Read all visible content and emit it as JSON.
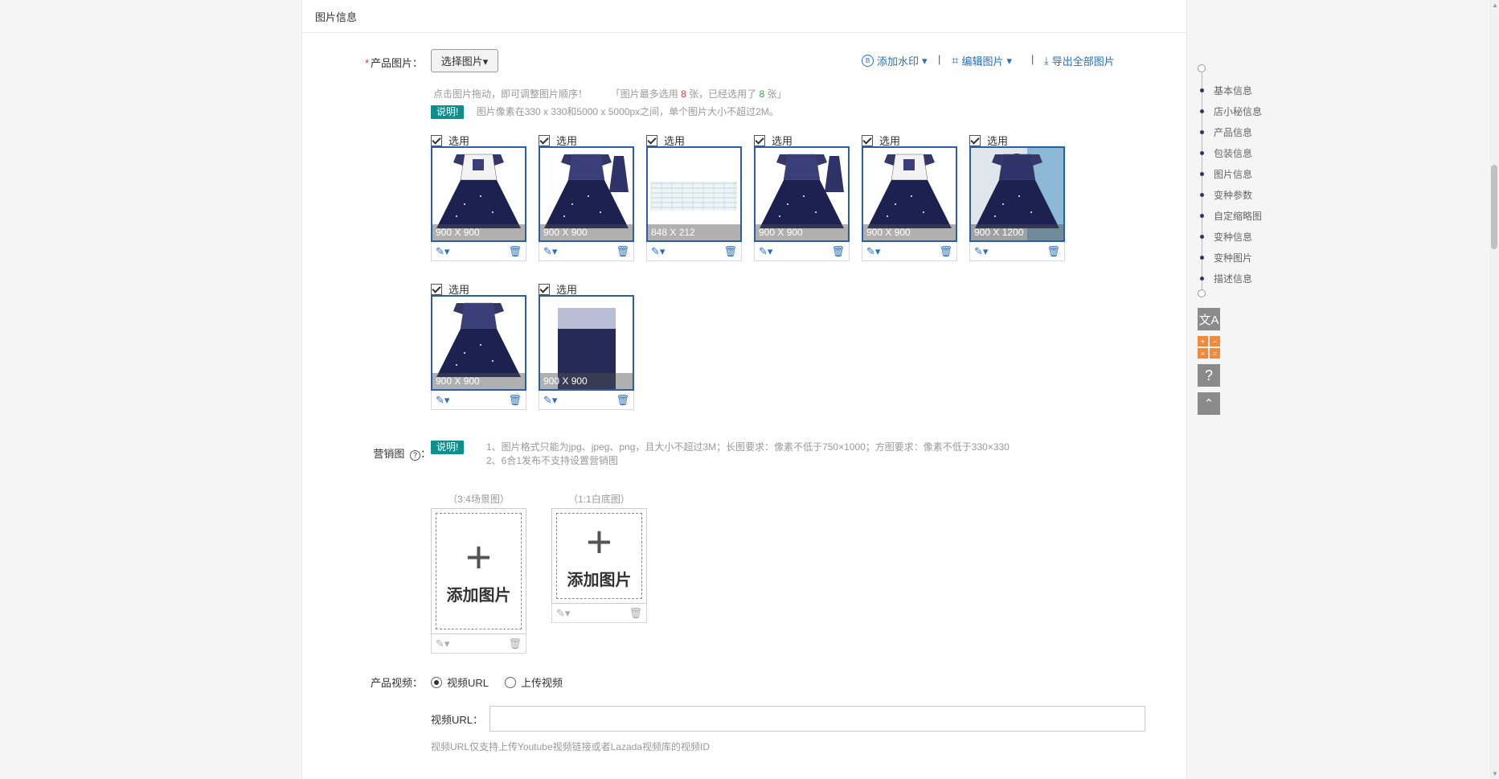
{
  "section": {
    "title": "图片信息"
  },
  "product_images": {
    "label": "产品图片：",
    "required_mark": "*",
    "select_button": "选择图片▾",
    "add_watermark": "添加水印",
    "edit_image": "编辑图片",
    "export_all": "导出全部图片",
    "separator": "|",
    "drag_tip": "点击图片拖动，即可调整图片顺序！",
    "count_tip_prefix": "「图片最多选用",
    "max_count": "8",
    "count_tip_mid": "张，已经选用了",
    "used_count": "8",
    "count_tip_suffix": "张」",
    "note_badge": "说明!",
    "note_text": "图片像素在330 x 330和5000 x 5000px之间，单个图片大小不超过2M。",
    "check_label": "选用",
    "images": [
      {
        "size": "900 X 900",
        "kind": "dress-white"
      },
      {
        "size": "900 X 900",
        "kind": "dress-blue-double"
      },
      {
        "size": "848 X 212",
        "kind": "size-chart"
      },
      {
        "size": "900 X 900",
        "kind": "dress-blue-double"
      },
      {
        "size": "900 X 900",
        "kind": "dress-white"
      },
      {
        "size": "900 X 1200",
        "kind": "dress-model"
      },
      {
        "size": "900 X 900",
        "kind": "dress-flat"
      },
      {
        "size": "900 X 900",
        "kind": "fabric"
      }
    ]
  },
  "marketing": {
    "label": "营销图",
    "badge": "说明!",
    "note1": "1、图片格式只能为jpg、jpeg、png，且大小不超过3M；长图要求：像素不低于750×1000；方图要求：像素不低于330×330",
    "note2": "2、6合1发布不支持设置营销图",
    "slot1_caption": "（3:4场景图）",
    "slot2_caption": "（1:1白底图）",
    "add_image": "添加图片"
  },
  "video": {
    "label": "产品视频：",
    "option_url": "视频URL",
    "option_upload": "上传视频",
    "url_label": "视频URL：",
    "url_value": "",
    "hint": "视频URL仅支持上传Youtube视频链接或者Lazada视频库的视频ID"
  },
  "side_nav": {
    "items": [
      "基本信息",
      "店小秘信息",
      "产品信息",
      "包装信息",
      "图片信息",
      "变种参数",
      "自定缩略图",
      "变种信息",
      "变种图片",
      "描述信息"
    ]
  },
  "icons": {
    "translate": "translate-icon",
    "calculator": "calculator-icon",
    "help": "help-icon",
    "top": "back-to-top-icon"
  },
  "colors": {
    "accent": "#2a6ebb",
    "badge": "#0e8e8c",
    "frame": "#2a5fa8"
  }
}
